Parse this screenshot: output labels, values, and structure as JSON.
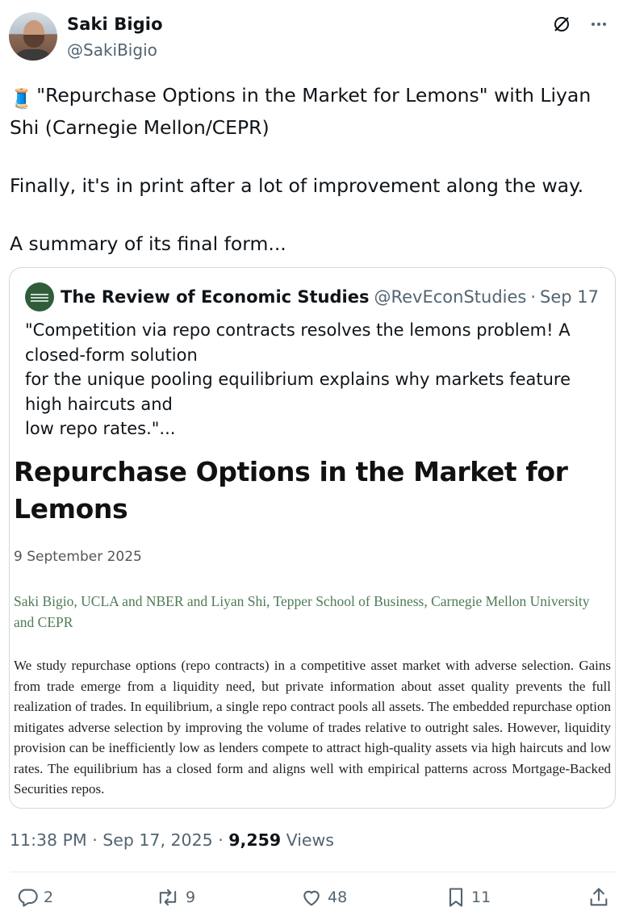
{
  "author": {
    "name": "Saki Bigio",
    "handle": "@SakiBigio"
  },
  "tweet": {
    "thread_emoji": "🧵",
    "text": "\"Repurchase Options in the Market for Lemons\" with Liyan Shi (Carnegie Mellon/CEPR)\n\nFinally, it's in print after a lot of improvement along the way.\n\nA summary of its final form..."
  },
  "quote": {
    "account_name": "The Review of Economic Studies",
    "account_handle": "@RevEconStudies",
    "date": "Sep 17",
    "text": "\"Competition via repo contracts resolves the lemons problem! A closed-form solution\nfor the unique pooling equilibrium explains why markets feature high haircuts and\nlow repo rates.\"...",
    "paper": {
      "title": "Repurchase Options in the Market for Lemons",
      "date": "9 September 2025",
      "authors": "Saki Bigio, UCLA and NBER and Liyan Shi, Tepper School of Business, Carnegie Mellon University and CEPR",
      "abstract": "We study repurchase options (repo contracts) in a competitive asset market with adverse selection. Gains from trade emerge from a liquidity need, but private information about asset quality prevents the full realization of trades. In equilibrium, a single repo contract pools all assets. The embedded repurchase option mitigates adverse selection by improving the volume of trades relative to outright sales. However, liquidity provision can be inefficiently low as lenders compete to attract high-quality assets via high haircuts and low rates. The equilibrium has a closed form and aligns well with empirical patterns across Mortgage-Backed Securities repos."
    }
  },
  "meta": {
    "time": "11:38 PM",
    "date": "Sep 17, 2025",
    "views_count": "9,259",
    "views_label": "Views"
  },
  "actions": {
    "replies": "2",
    "reposts": "9",
    "likes": "48",
    "bookmarks": "11"
  },
  "icons": [
    "grok-icon",
    "more-icon",
    "reply-icon",
    "repost-icon",
    "like-icon",
    "bookmark-icon",
    "share-icon"
  ],
  "colors": {
    "text": "#0f1419",
    "secondary": "#536471",
    "border": "#cfd9de",
    "paper_author_green": "#4e7b57"
  }
}
